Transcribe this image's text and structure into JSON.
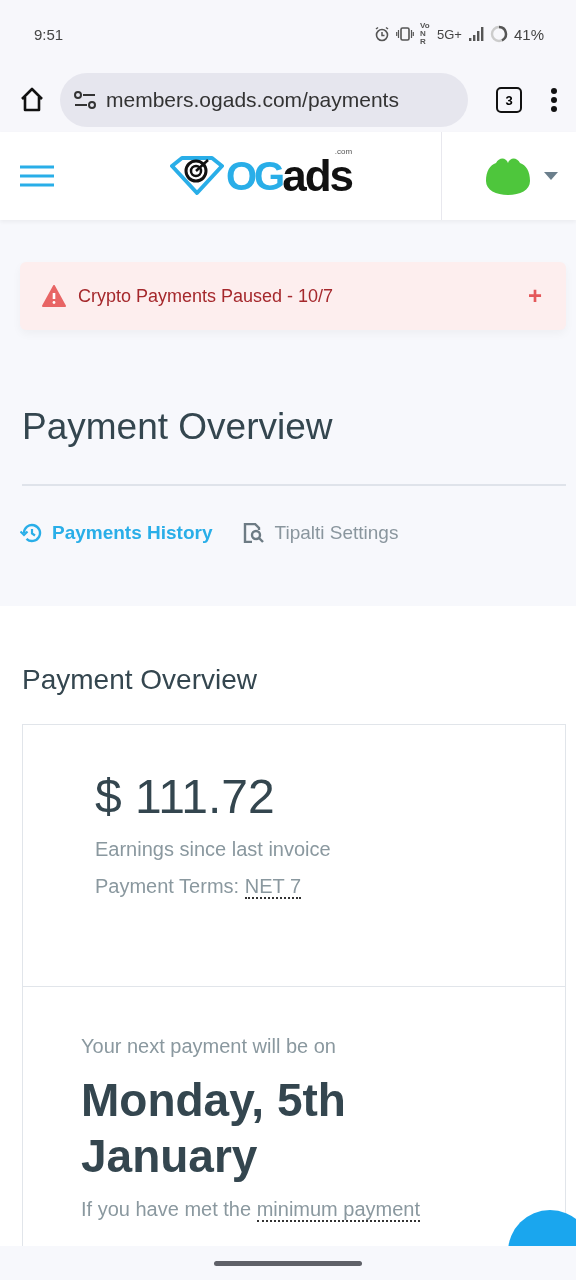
{
  "status_bar": {
    "time": "9:51",
    "vonr": "VoNR",
    "network": "5G+",
    "battery": "41%"
  },
  "browser": {
    "url": "members.ogads.com/payments",
    "tab_count": "3"
  },
  "header": {
    "logo": {
      "og": "OG",
      "ads": "ads",
      "tld": ".com"
    }
  },
  "alert": {
    "text": "Crypto Payments Paused - 10/7",
    "expand": "+"
  },
  "page_title": "Payment Overview",
  "tabs": [
    {
      "label": "Payments History",
      "selected": true
    },
    {
      "label": "Tipalti Settings",
      "selected": false
    }
  ],
  "section_title": "Payment Overview",
  "balance": {
    "amount": "$ 111.72",
    "caption": "Earnings since last invoice",
    "terms_label": "Payment Terms:",
    "terms_value": "NET 7"
  },
  "next_payment": {
    "intro": "Your next payment will be on",
    "date": "Monday, 5th January",
    "note_before": "If you have met the",
    "note_link": "minimum payment"
  }
}
